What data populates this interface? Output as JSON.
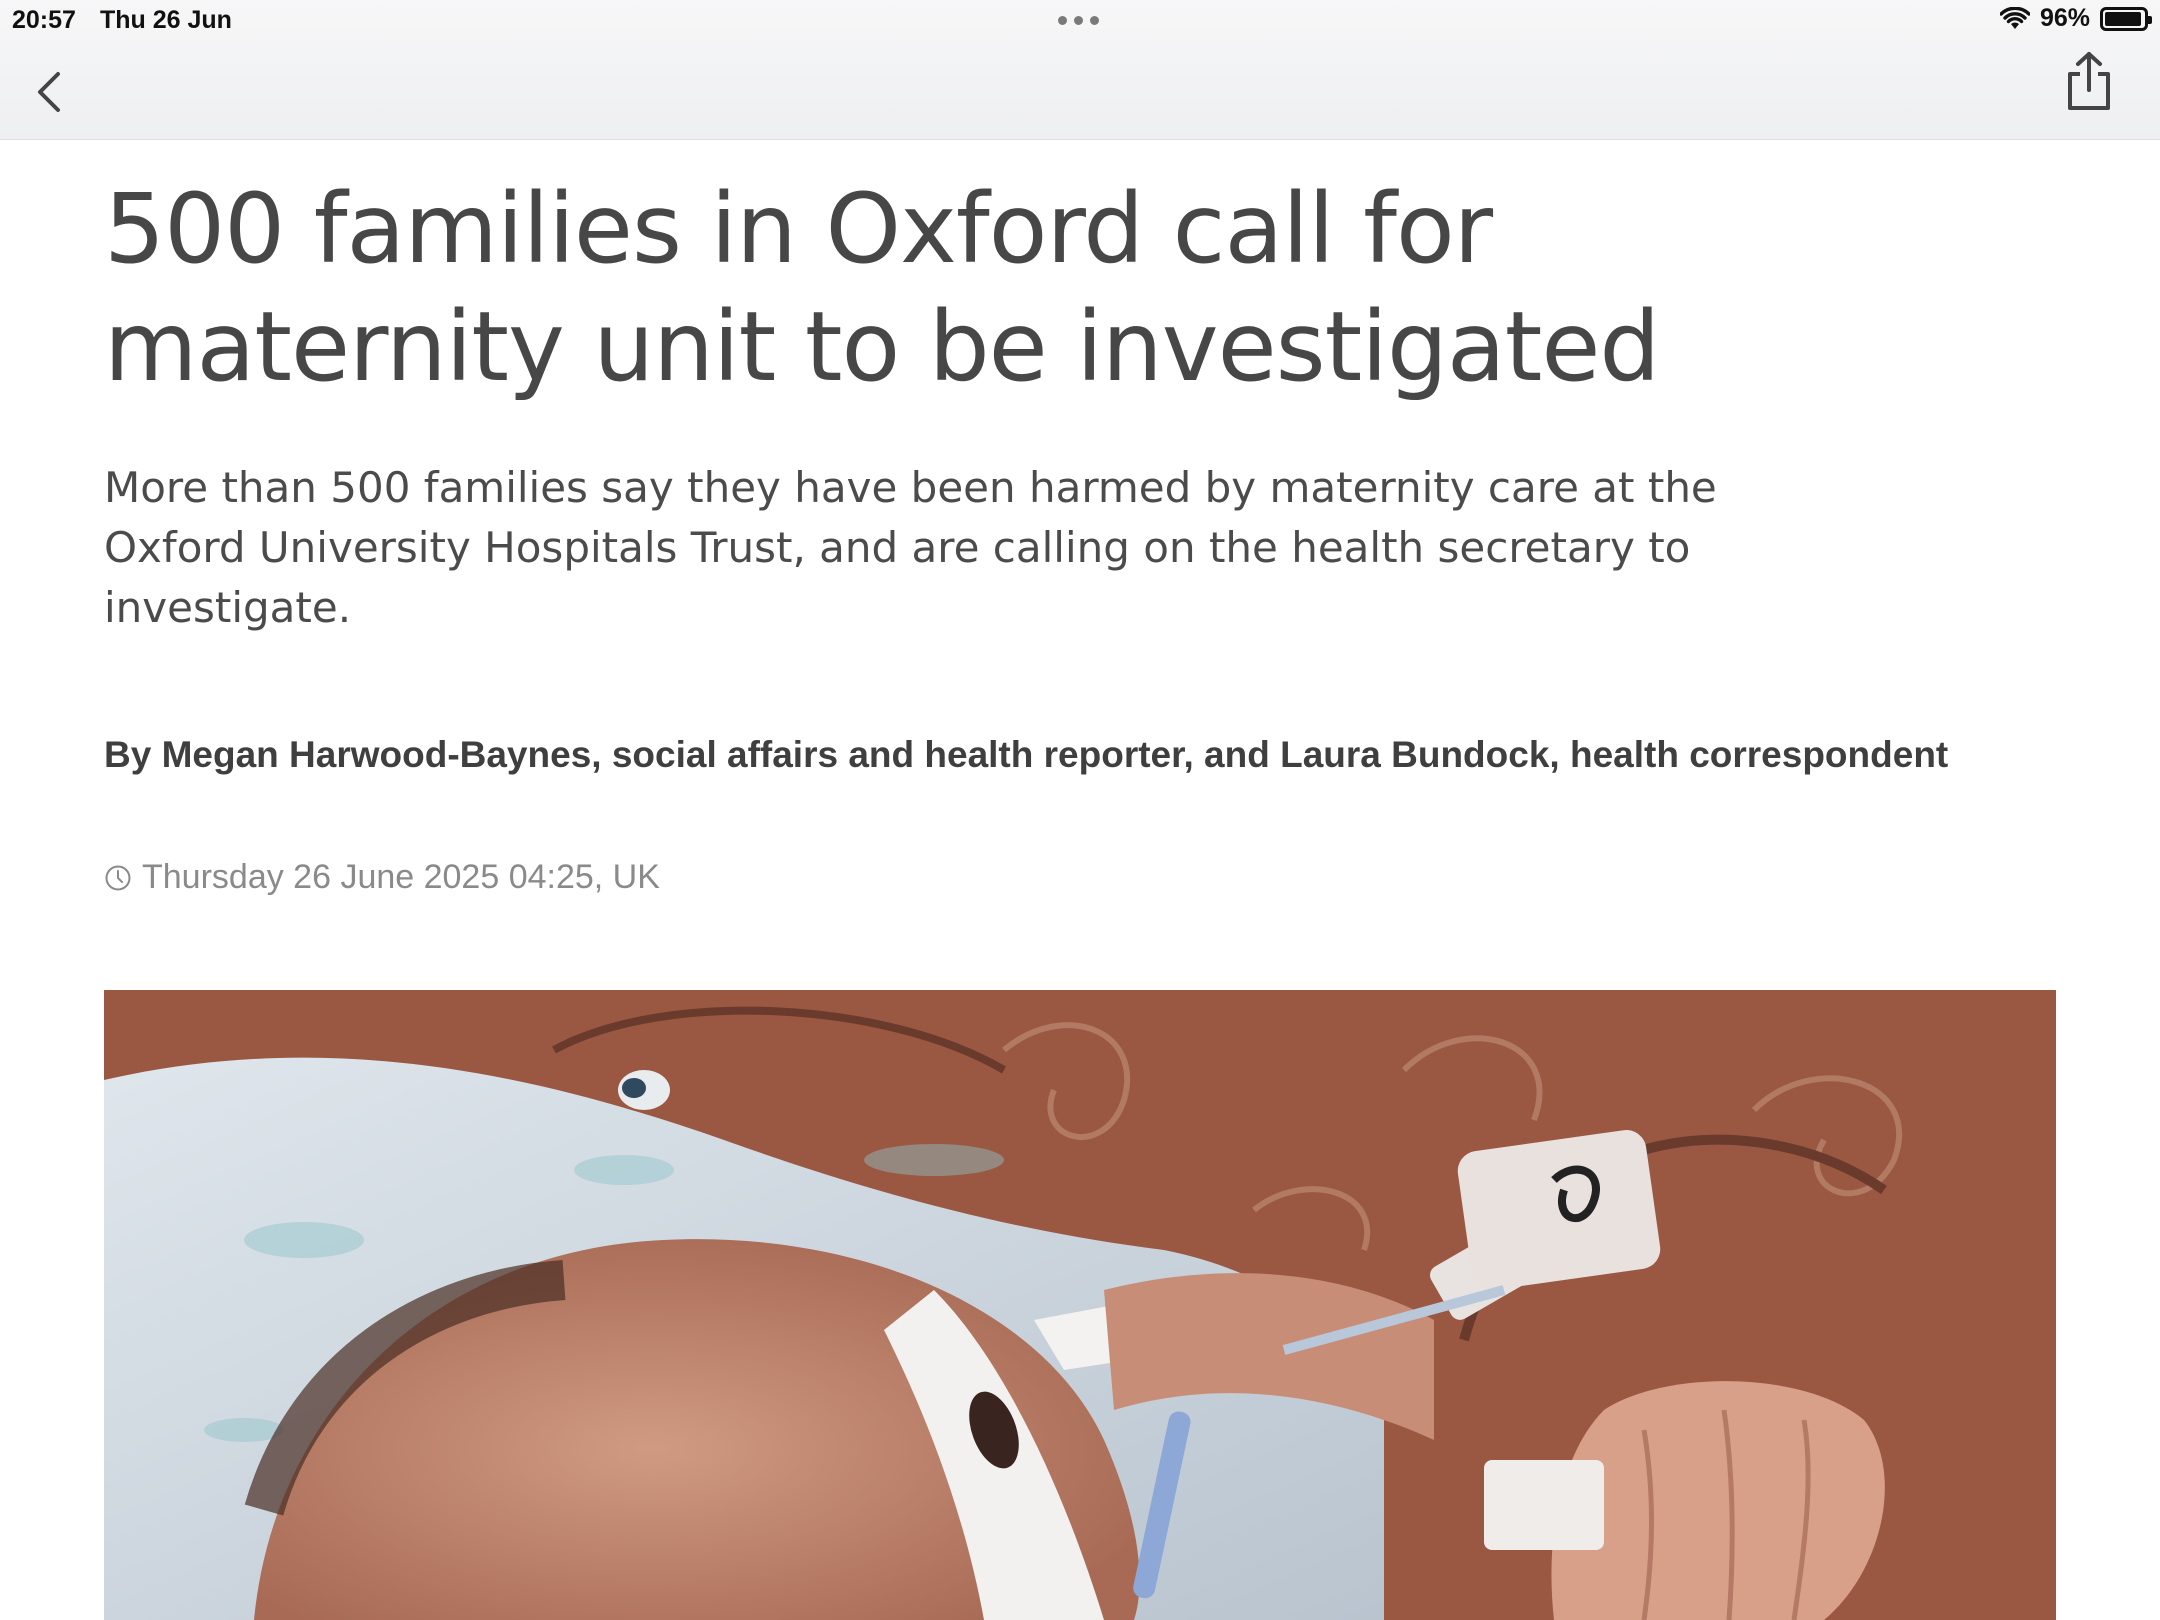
{
  "status_bar": {
    "time": "20:57",
    "date": "Thu 26 Jun",
    "battery": "96%",
    "battery_level": 0.96
  },
  "nav": {
    "back_icon": "chevron-left-icon",
    "share_icon": "share-icon"
  },
  "article": {
    "headline": "500 families in Oxford call for maternity unit to be investigated",
    "standfirst": "More than 500 families say they have been harmed by maternity care at the Oxford University Hospitals Trust, and are calling on the health secretary to investigate.",
    "byline": "By Megan Harwood-Baynes, social affairs and health reporter, and Laura Bundock, health correspondent",
    "timestamp": "Thursday 26 June 2025 04:25, UK",
    "clock_icon": "clock-icon"
  },
  "colors": {
    "headline": "#474747",
    "meta": "#8a8a8a",
    "topbar": "#f2f2f4"
  }
}
